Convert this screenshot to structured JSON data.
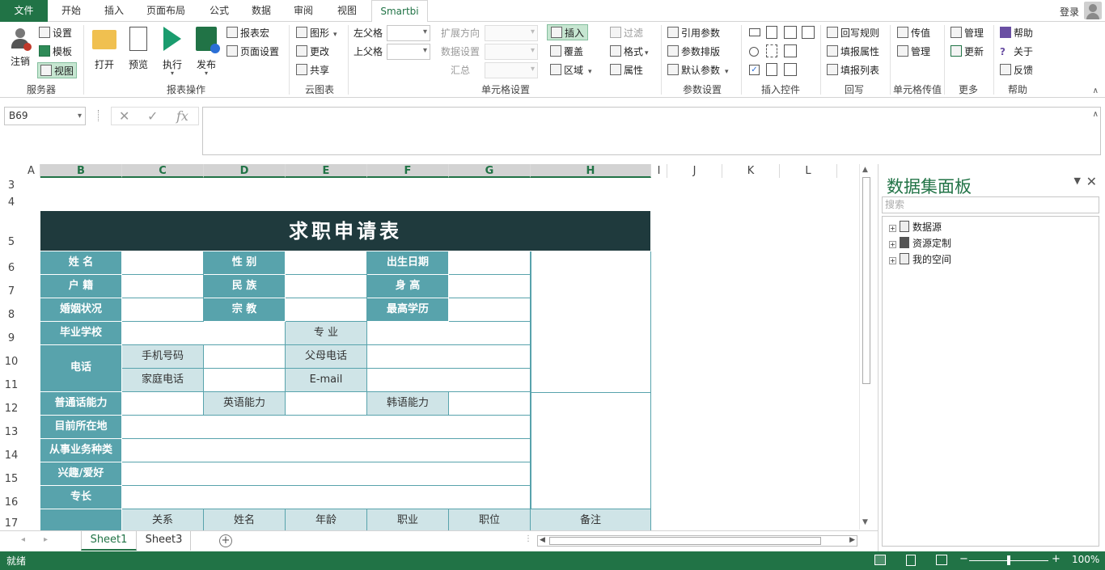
{
  "tabs": {
    "file": "文件",
    "home": "开始",
    "insert": "插入",
    "layout": "页面布局",
    "formula": "公式",
    "data": "数据",
    "review": "审阅",
    "view": "视图",
    "smartbi": "Smartbi",
    "login": "登录"
  },
  "ribbon": {
    "server": {
      "logout": "注销",
      "settings": "设置",
      "template": "模板",
      "view": "视图",
      "label": "服务器"
    },
    "report_ops": {
      "open": "打开",
      "preview": "预览",
      "execute": "执行",
      "publish": "发布",
      "macro": "报表宏",
      "page_setup": "页面设置",
      "label": "报表操作"
    },
    "cloud": {
      "chart": "图形",
      "change": "更改",
      "share": "共享",
      "label": "云图表"
    },
    "cell_settings": {
      "left_parent": "左父格",
      "top_parent": "上父格",
      "expand_dir": "扩展方向",
      "data_settings": "数据设置",
      "summary": "汇总",
      "insert": "插入",
      "overwrite": "覆盖",
      "area": "区域",
      "filter": "过滤",
      "format": "格式",
      "property": "属性",
      "label": "单元格设置"
    },
    "params": {
      "ref_param": "引用参数",
      "param_layout": "参数排版",
      "default_param": "默认参数",
      "label": "参数设置"
    },
    "controls": {
      "label": "插入控件"
    },
    "writeback": {
      "rules": "回写规则",
      "fill_props": "填报属性",
      "fill_list": "填报列表",
      "label": "回写"
    },
    "cell_value": {
      "pass_value": "传值",
      "manage": "管理",
      "label": "单元格传值"
    },
    "more": {
      "manage": "管理",
      "update": "更新",
      "label": "更多"
    },
    "help": {
      "help": "帮助",
      "about": "关于",
      "feedback": "反馈",
      "label": "帮助"
    }
  },
  "formula_bar": {
    "name_box": "B69",
    "cancel": "✕",
    "enter": "✓",
    "fx": "fx",
    "content": ""
  },
  "columns": [
    "A",
    "B",
    "C",
    "D",
    "E",
    "F",
    "G",
    "H",
    "I",
    "J",
    "K",
    "L"
  ],
  "rows": [
    "3",
    "4",
    "5",
    "6",
    "7",
    "8",
    "9",
    "10",
    "11",
    "12",
    "13",
    "14",
    "15",
    "16",
    "17"
  ],
  "form": {
    "title": "求职申请表",
    "name": "姓  名",
    "gender": "性 别",
    "birth": "出生日期",
    "hukou": "户  籍",
    "ethnic": "民 族",
    "height": "身  高",
    "marital": "婚姻状况",
    "religion": "宗 教",
    "education": "最高学历",
    "school": "毕业学校",
    "major": "专  业",
    "phone": "电话",
    "mobile": "手机号码",
    "parent_phone": "父母电话",
    "home_phone": "家庭电话",
    "email": "E-mail",
    "mandarin": "普通话能力",
    "english": "英语能力",
    "korean": "韩语能力",
    "location": "目前所在地",
    "business": "从事业务种类",
    "hobby": "兴趣/爱好",
    "specialty": "专长",
    "family_headers": [
      "关系",
      "姓名",
      "年龄",
      "职业",
      "职位",
      "备注"
    ]
  },
  "sheets": [
    "Sheet1",
    "Sheet3"
  ],
  "panel": {
    "title": "数据集面板",
    "search_placeholder": "搜索",
    "tree": [
      "数据源",
      "资源定制",
      "我的空间"
    ]
  },
  "status": {
    "ready": "就绪",
    "zoom": "100%"
  },
  "colors": {
    "excel_green": "#217346",
    "title_bar": "#1f3a3d",
    "label_teal": "#58a3ac",
    "light_teal": "#cfe4e7"
  }
}
